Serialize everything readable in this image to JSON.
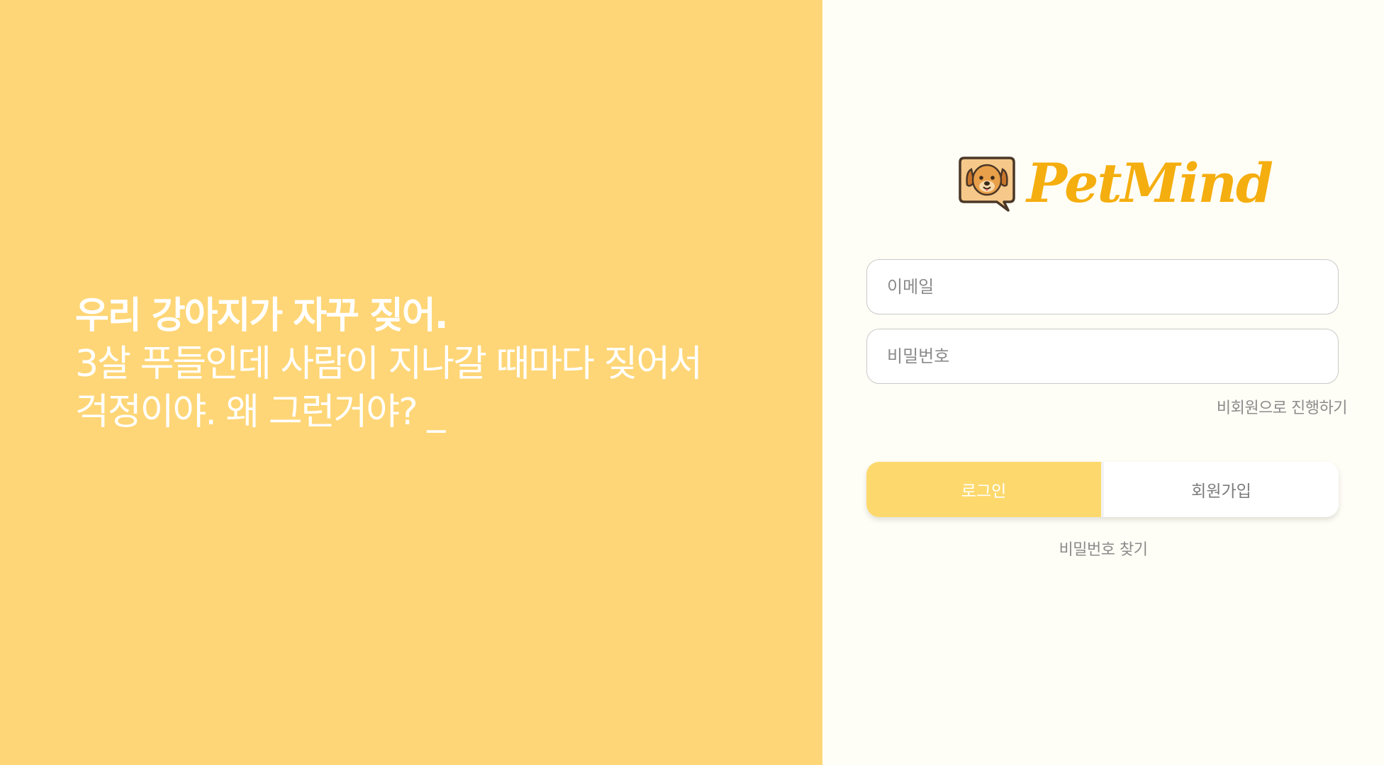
{
  "hero": {
    "line1": "우리 강아지가 자꾸 짖어.",
    "line2": "3살 푸들인데 사람이 지나갈 때마다 짖어서",
    "line3": "걱정이야. 왜 그런거야? _"
  },
  "logo": {
    "name": "PetMind",
    "icon": "dog-speech-bubble-icon"
  },
  "form": {
    "email_placeholder": "이메일",
    "password_placeholder": "비밀번호",
    "guest_link": "비회원으로 진행하기",
    "login_label": "로그인",
    "signup_label": "회원가입",
    "find_password": "비밀번호 찾기"
  },
  "colors": {
    "hero_bg": "#FED677",
    "login_bg": "#FFFEF6",
    "brand": "#F5AE0F",
    "login_button": "#FDD96D"
  }
}
